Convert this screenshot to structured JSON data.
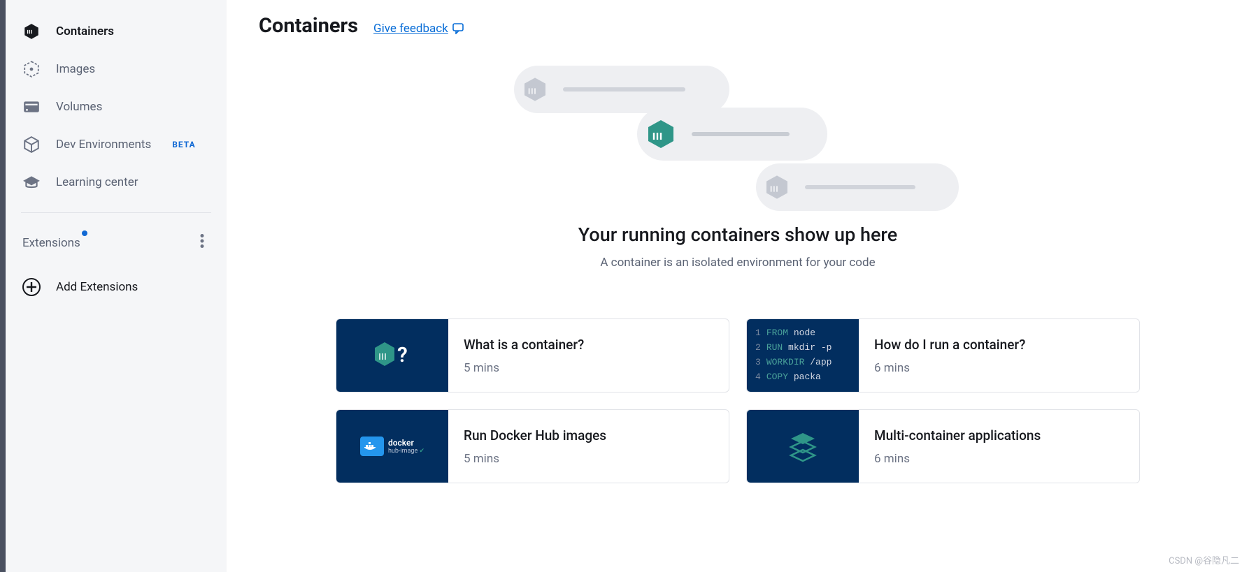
{
  "sidebar": {
    "items": [
      {
        "label": "Containers"
      },
      {
        "label": "Images"
      },
      {
        "label": "Volumes"
      },
      {
        "label": "Dev Environments",
        "badge": "BETA"
      },
      {
        "label": "Learning center"
      }
    ],
    "extensions_label": "Extensions",
    "add_extensions_label": "Add Extensions"
  },
  "header": {
    "title": "Containers",
    "feedback_label": "Give feedback"
  },
  "empty_state": {
    "title": "Your running containers show up here",
    "subtitle": "A container is an isolated environment for your code"
  },
  "cards": [
    {
      "title": "What is a container?",
      "time": "5 mins"
    },
    {
      "title": "How do I run a container?",
      "time": "6 mins"
    },
    {
      "title": "Run Docker Hub images",
      "time": "5 mins"
    },
    {
      "title": "Multi-container applications",
      "time": "6 mins"
    }
  ],
  "code_sample": {
    "lines": [
      {
        "n": "1",
        "kw": "FROM",
        "tx": "node"
      },
      {
        "n": "2",
        "kw": "RUN",
        "tx": "mkdir -p"
      },
      {
        "n": "3",
        "kw": "WORKDIR",
        "tx": "/app"
      },
      {
        "n": "4",
        "kw": "COPY",
        "tx": "packa"
      }
    ]
  },
  "docker_hub": {
    "name": "docker",
    "sub": "hub-image"
  },
  "watermark": "CSDN @谷隐凡二"
}
